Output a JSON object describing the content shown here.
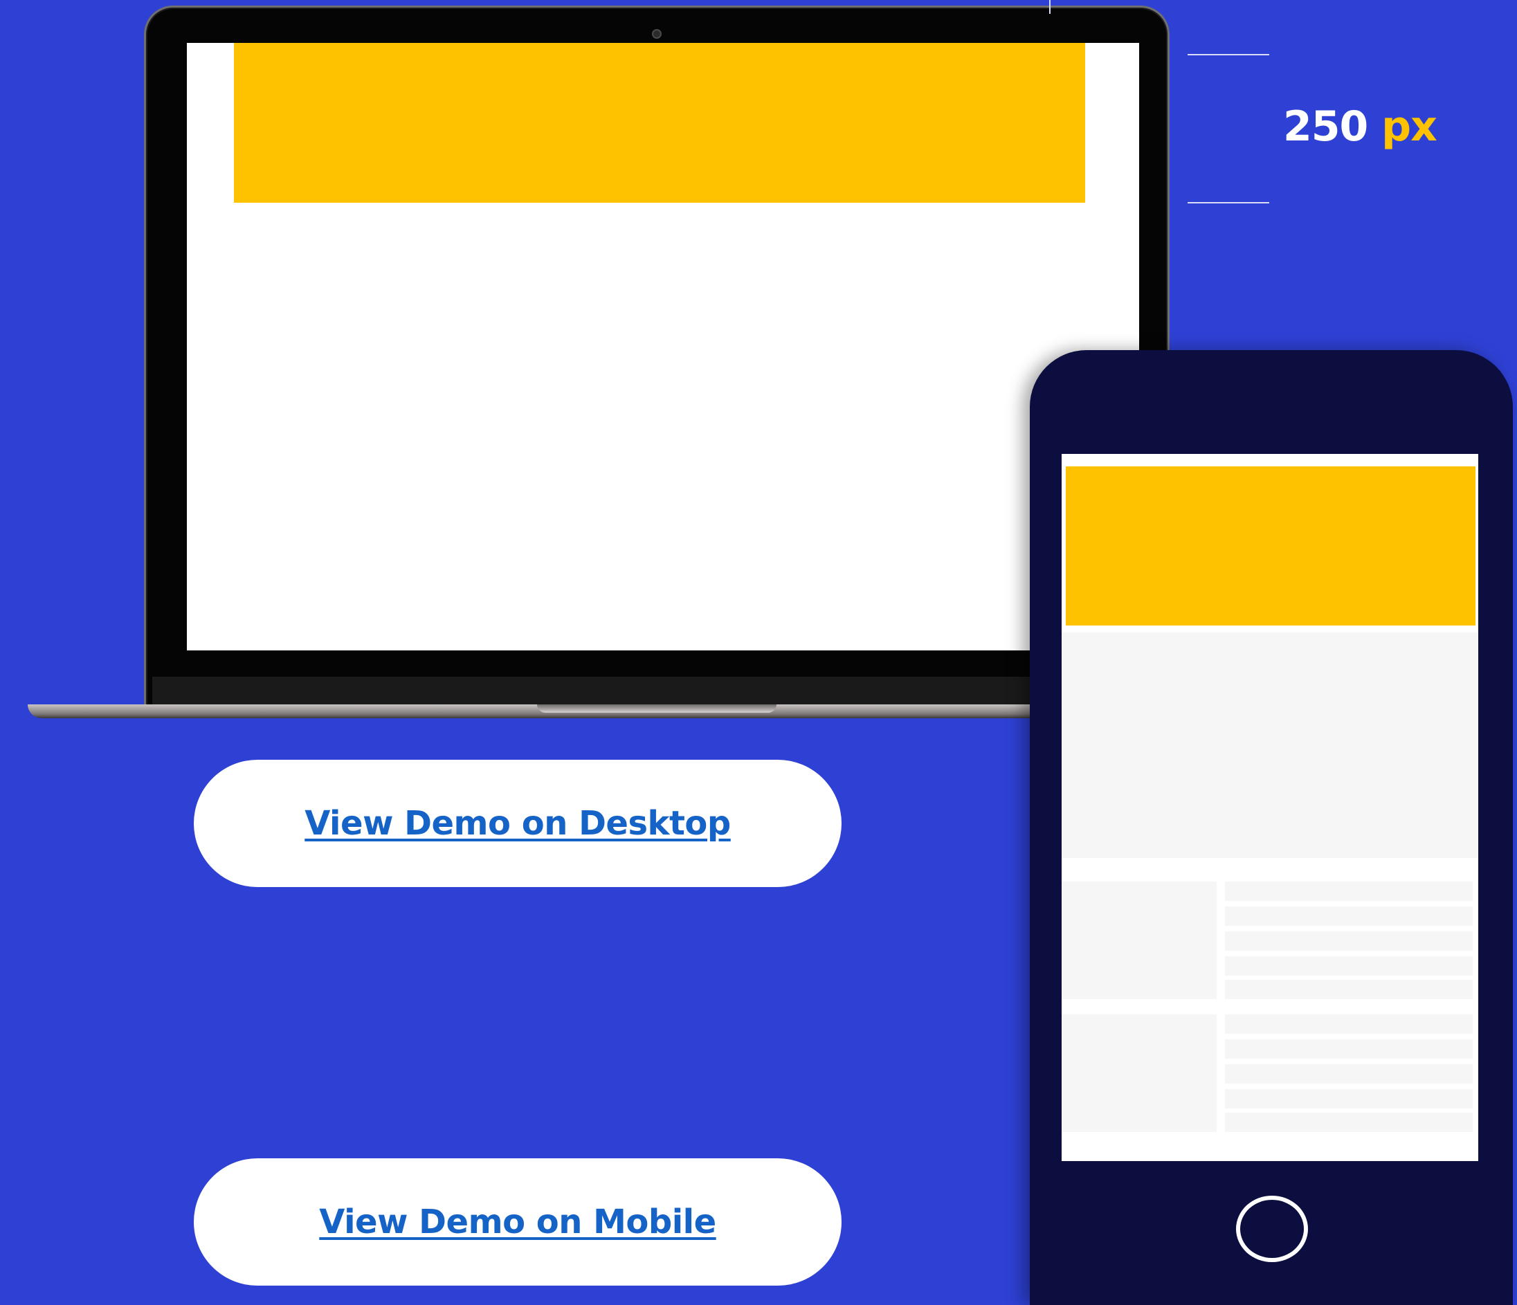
{
  "annotation": {
    "value": "250",
    "unit": "px"
  },
  "buttons": {
    "desktop_label": "View Demo on Desktop",
    "mobile_label": "View Demo on Mobile"
  },
  "colors": {
    "background": "#2e41d4",
    "accent": "#ffc200",
    "link": "#1663c7",
    "phone_body": "#0c0e40"
  },
  "icons": {
    "home_button": "home-button-icon",
    "camera": "camera-icon"
  }
}
